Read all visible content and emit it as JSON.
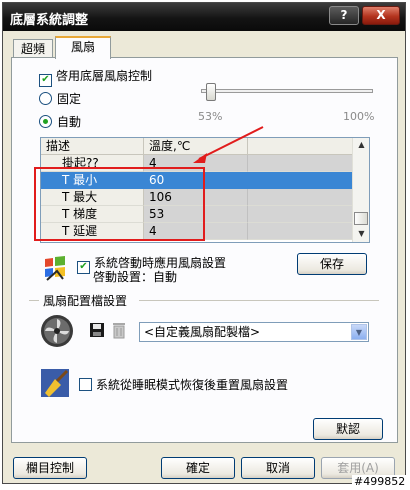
{
  "window": {
    "title": "底層系統調整",
    "help_label": "?",
    "close_label": "X"
  },
  "tabs": [
    {
      "label": "超頻"
    },
    {
      "label": "風扇"
    }
  ],
  "fan_control": {
    "enable_label": "啓用底層風扇控制",
    "enable_checked": true,
    "mode_fixed_label": "固定",
    "mode_auto_label": "自動",
    "selected_mode": "auto",
    "slider_min_label": "53%",
    "slider_max_label": "100%",
    "slider_value_percent": 53
  },
  "grid": {
    "headers": [
      "描述",
      "溫度,℃",
      ""
    ],
    "rows": [
      {
        "label": "掛起??",
        "value": "4"
      },
      {
        "label": "T 最小",
        "value": "60",
        "selected": true
      },
      {
        "label": "T 最大",
        "value": "106"
      },
      {
        "label": "T 梯度",
        "value": "53"
      },
      {
        "label": "T 延遲",
        "value": "4"
      }
    ]
  },
  "startup": {
    "apply_label": "系統啓動時應用風扇設置",
    "apply_checked": true,
    "startup_setting_label": "啓動設置：",
    "startup_setting_value": "自動",
    "save_button": "保存"
  },
  "profile": {
    "section_title": "風扇配置檔設置",
    "dropdown_value": "<自定義風扇配製檔>",
    "restore_label": "系統從睡眠模式恢復後重置風扇設置",
    "restore_checked": false
  },
  "buttons": {
    "default": "默認",
    "taskbar": "欄目控制",
    "ok": "確定",
    "cancel": "取消",
    "apply": "套用(A)"
  },
  "watermark": "#499852",
  "colors": {
    "selection": "#3a86d4",
    "annotation": "#e11c1c",
    "checkmark": "#21a121"
  }
}
